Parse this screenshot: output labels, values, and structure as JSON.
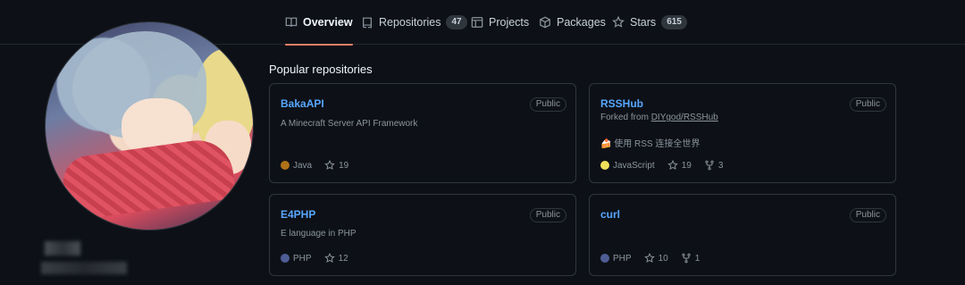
{
  "tabs": [
    {
      "label": "Overview",
      "icon": "book-icon"
    },
    {
      "label": "Repositories",
      "count": "47",
      "icon": "repo-icon"
    },
    {
      "label": "Projects",
      "icon": "table-icon"
    },
    {
      "label": "Packages",
      "icon": "package-icon"
    },
    {
      "label": "Stars",
      "count": "615",
      "icon": "star-icon"
    }
  ],
  "section_title": "Popular repositories",
  "repos": [
    {
      "name": "BakaAPI",
      "visibility": "Public",
      "description": "A Minecraft Server API Framework",
      "language": "Java",
      "language_color": "#b07219",
      "stars": "19"
    },
    {
      "name": "RSSHub",
      "visibility": "Public",
      "forked_prefix": "Forked from",
      "forked_from": "DIYgod/RSSHub",
      "description": "🍰 使用 RSS 连接全世界",
      "language": "JavaScript",
      "language_color": "#f1e05a",
      "stars": "19",
      "forks": "3"
    },
    {
      "name": "E4PHP",
      "visibility": "Public",
      "description": "E language in PHP",
      "language": "PHP",
      "language_color": "#4f5d95",
      "stars": "12"
    },
    {
      "name": "curl",
      "visibility": "Public",
      "language": "PHP",
      "language_color": "#4f5d95",
      "stars": "10",
      "forks": "1"
    }
  ],
  "colors": {
    "accent": "#f78166",
    "link": "#58a6ff",
    "background": "#0d1117"
  }
}
